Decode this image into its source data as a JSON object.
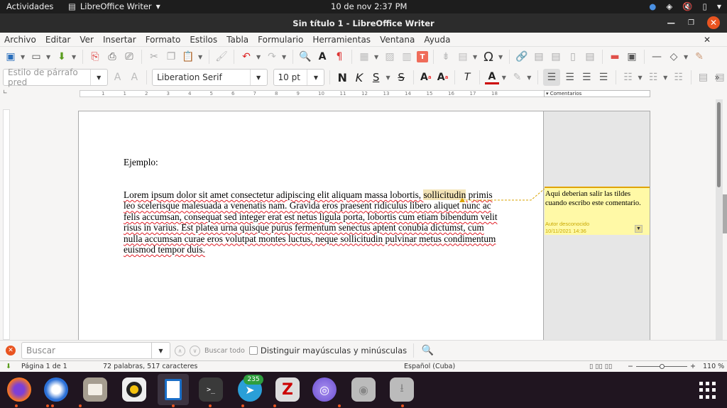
{
  "topbar": {
    "activities": "Actividades",
    "app_name": "LibreOffice Writer",
    "clock": "10 de nov   2:37 PM"
  },
  "window": {
    "title": "Sin título 1 - LibreOffice Writer",
    "minimize": "—",
    "restore": "❐",
    "close": "✕"
  },
  "menu": {
    "items": [
      "Archivo",
      "Editar",
      "Ver",
      "Insertar",
      "Formato",
      "Estilos",
      "Tabla",
      "Formulario",
      "Herramientas",
      "Ventana",
      "Ayuda"
    ],
    "close_doc": "✕"
  },
  "format": {
    "paragraph_style": "Estilo de párrafo pred",
    "font_name": "Liberation Serif",
    "font_size": "10 pt",
    "bold": "N",
    "italic": "K",
    "underline": "S",
    "strike": "S"
  },
  "ruler": {
    "comments_label": "▾ Comentarios",
    "ticks": [
      "1",
      "1",
      "2",
      "3",
      "4",
      "5",
      "6",
      "7",
      "8",
      "9",
      "10",
      "11",
      "12",
      "13",
      "14",
      "15",
      "16",
      "17",
      "18"
    ]
  },
  "document": {
    "heading": "Ejemplo:",
    "lines": [
      "Lorem ipsum dolor sit amet consectetur adipiscing elit aliquam massa lobortis, ",
      "leo scelerisque malesuada a venenatis nam. Gravida eros praesent ridiculus libero aliquet nunc ac",
      "felis accumsan, consequat sed integer erat est netus ligula porta, lobortis cum etiam bibendum velit",
      "risus in varius. Est platea urna quisque purus fermentum senectus aptent conubia dictumst, cum",
      "nulla accumsan curae eros volutpat montes luctus, neque sollicitudin pulvinar metus condimentum",
      "euismod tempor duis."
    ],
    "highlighted_word": "sollicitudin",
    "line1_tail": " primis"
  },
  "comment": {
    "text": "Aqui deberian salir las tildes cuando escribo este comentario.",
    "author": "Autor desconocido",
    "date": "10/11/2021 14:36"
  },
  "find": {
    "placeholder": "Buscar",
    "find_all": "Buscar todo",
    "match_case": "Distinguir mayúsculas y minúsculas",
    "match_case_checked": false
  },
  "status": {
    "page": "Página 1 de 1",
    "words": "72 palabras, 517 caracteres",
    "language": "Español (Cuba)",
    "zoom": "110 %",
    "zoom_minus": "−",
    "zoom_plus": "+"
  },
  "dock": {
    "apps": [
      "Firefox",
      "Thunderbird",
      "Archivos",
      "Rhythmbox",
      "LibreOffice Writer",
      "Terminal",
      "Telegram",
      "Zotero",
      "Navegador de red",
      "Disco",
      "USB"
    ],
    "telegram_badge": "235"
  },
  "colors": {
    "accent": "#e95420",
    "comment_bg": "#fff9a6",
    "comment_border": "#e0a400"
  }
}
